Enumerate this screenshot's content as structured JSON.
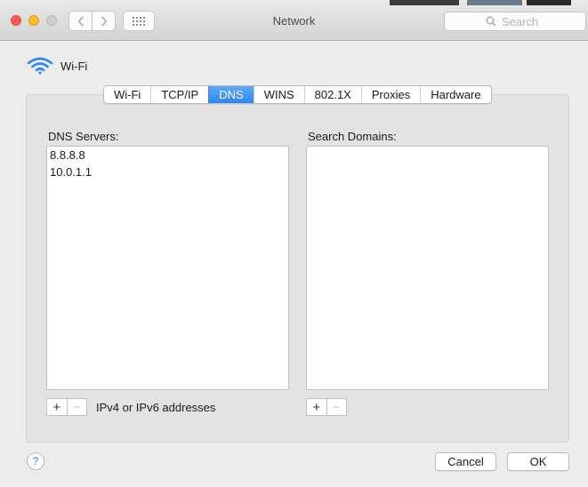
{
  "window": {
    "title": "Network",
    "search_placeholder": "Search"
  },
  "interface": {
    "name": "Wi-Fi",
    "icon": "wifi-icon",
    "accent": "#2e87ef"
  },
  "tabs": [
    {
      "label": "Wi-Fi",
      "active": false
    },
    {
      "label": "TCP/IP",
      "active": false
    },
    {
      "label": "DNS",
      "active": true
    },
    {
      "label": "WINS",
      "active": false
    },
    {
      "label": "802.1X",
      "active": false
    },
    {
      "label": "Proxies",
      "active": false
    },
    {
      "label": "Hardware",
      "active": false
    }
  ],
  "dns_servers": {
    "label": "DNS Servers:",
    "entries": [
      "8.8.8.8",
      "10.0.1.1"
    ],
    "hint": "IPv4 or IPv6 addresses"
  },
  "search_domains": {
    "label": "Search Domains:",
    "entries": []
  },
  "controls": {
    "add_symbol": "+",
    "remove_symbol": "−",
    "help_symbol": "?"
  },
  "buttons": {
    "cancel": "Cancel",
    "ok": "OK"
  }
}
